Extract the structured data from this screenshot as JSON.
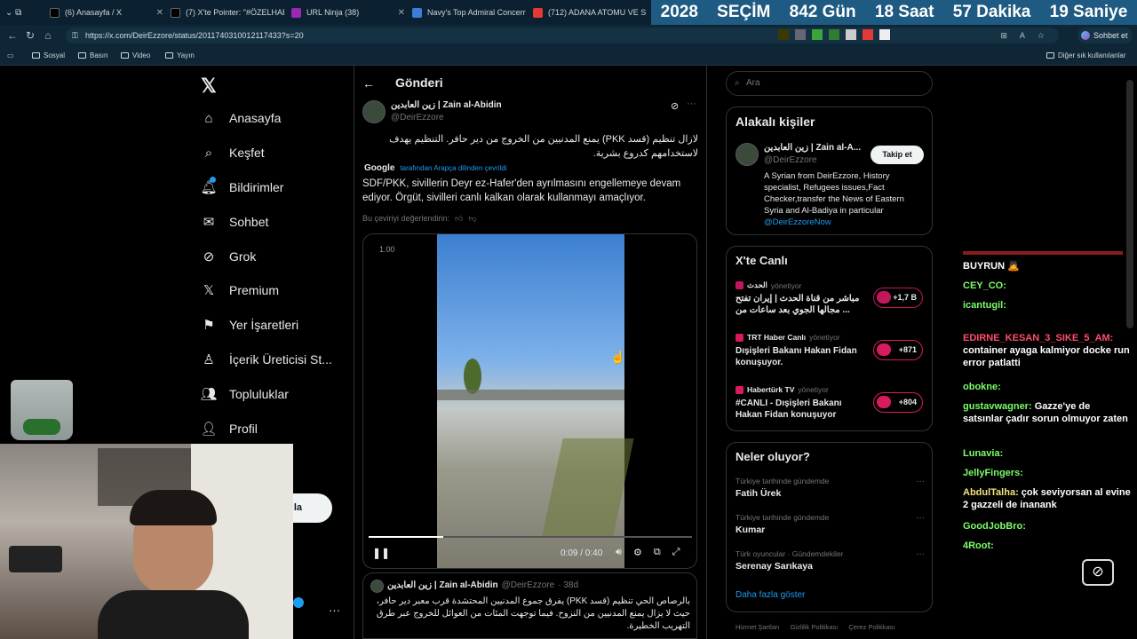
{
  "tabs": [
    {
      "label": "(6) Anasayfa / X",
      "fav": "#000"
    },
    {
      "label": "(7) X'te Pointer: \"#ÖZELHABER",
      "fav": "#000"
    },
    {
      "label": "URL Ninja (38)",
      "fav": "#9c27b0"
    },
    {
      "label": "Navy's Top Admiral Concerns",
      "fav": "#3b7dd8"
    },
    {
      "label": "(712) ADANA ATOMU VE SU",
      "fav": "#e53935"
    }
  ],
  "countdown": {
    "year": "2028",
    "word": "SEÇİM",
    "days": "842 Gün",
    "hours": "18 Saat",
    "minutes": "57 Dakika",
    "seconds": "19 Saniye"
  },
  "address": {
    "url": "https://x.com/DeirEzzore/status/2011740310012117433?s=20",
    "chat_label": "Sohbet et"
  },
  "bookmarks": [
    "Sosyal",
    "Basın",
    "Video",
    "Yayın"
  ],
  "bookmarks_other": "Diğer sık kullanılanlar",
  "nav": {
    "items": [
      "Anasayfa",
      "Keşfet",
      "Bildirimler",
      "Sohbet",
      "Grok",
      "Premium",
      "Yer İşaretleri",
      "İçerik Üreticisi St...",
      "Topluluklar",
      "Profil"
    ],
    "post_button_partial": "la"
  },
  "post": {
    "header": "Gönderi",
    "author_name": "زين العابدين | Zain al-Abidin",
    "author_handle": "@DeirEzzore",
    "arabic_text": "لازال تنظيم (قسد PKK) يمنع المدنيين من الخروج من دير حافر. التنظيم يهدف لاستخدامهم كدروع بشرية.",
    "translator": "Google",
    "translated_note": "tarafından Arapça dilinden çevrildi",
    "translation": "SDF/PKK, sivillerin Deyr ez-Hafer'den ayrılmasını engellemeye devam ediyor. Örgüt, sivilleri canlı kalkan olarak kullanmayı amaçlıyor.",
    "rate": "Bu çeviriyi değerlendirin:",
    "video": {
      "speed": "1.00",
      "time": "0:09 / 0:40",
      "progress": 0.23
    }
  },
  "quote": {
    "author_name": "زين العابدين | Zain al-Abidin",
    "author_handle": "@DeirEzzore",
    "age": "· 38d",
    "text": "بالرصاص الحي تنظيم (قسد PKK) يفرق جموع المدنيين المحتشدة قرب معبر دير حافر، حيث لا يزال يمنع المدنيين من النزوح. فيما توجهت المئات من العوائل للخروج عبر طرق التهريب الخطيرة."
  },
  "search": {
    "placeholder": "Ara"
  },
  "related": {
    "title": "Alakalı kişiler",
    "name": "زين العابدين | Zain al-A...",
    "handle": "@DeirEzzore",
    "follow": "Takip et",
    "bio": "A Syrian from DeirEzzore, History specialist, Refugees issues,Fact Checker,transfer the News of Eastern Syria and Al-Badiya in particular",
    "link": "@DeirEzzoreNow"
  },
  "live": {
    "title": "X'te Canlı",
    "items": [
      {
        "host": "الحدث",
        "role": "yönetiyor",
        "text": "مباشر من قناة الحدث | إيران تفتح مجالها الجوي بعد ساعات من ...",
        "count": "+1,7 B",
        "color": "#c2185b"
      },
      {
        "host": "TRT Haber Canlı",
        "role": "yönetiyor",
        "text": "Dışişleri Bakanı Hakan Fidan konuşuyor.",
        "count": "+871",
        "color": "#d81b60"
      },
      {
        "host": "Habertürk TV",
        "role": "yönetiyor",
        "text": "#CANLI - Dışişleri Bakanı Hakan Fidan konuşuyor",
        "count": "+804",
        "color": "#d81b60"
      }
    ]
  },
  "trends": {
    "title": "Neler oluyor?",
    "items": [
      {
        "context": "Türkiye tarihinde gündemde",
        "name": "Fatih Ürek"
      },
      {
        "context": "Türkiye tarihinde gündemde",
        "name": "Kumar"
      },
      {
        "context": "Türk oyuncular · Gündemdekiler",
        "name": "Serenay Sarıkaya"
      }
    ],
    "more": "Daha fazla göster"
  },
  "footer_links": [
    "Hizmet Şartları",
    "Gizlilik Politikası",
    "Çerez Politikası"
  ],
  "chat": [
    {
      "user": "",
      "msg": "BUYRUN 🙇"
    },
    {
      "user": "CEY_CO:",
      "msg": ""
    },
    {
      "user": "icantugil:",
      "msg": ""
    },
    {
      "user": "EDIRNE_KESAN_3_SIKE_5_AM:",
      "msg": "container ayaga kalmiyor docke run error patlatti"
    },
    {
      "user": "obokne:",
      "msg": ""
    },
    {
      "user": "gustavwagner:",
      "msg": "Gazze'ye de satsınlar çadır sorun olmuyor zaten"
    },
    {
      "user": "Lunavia:",
      "msg": ""
    },
    {
      "user": "JellyFingers:",
      "msg": ""
    },
    {
      "user": "AbdulTalha:",
      "msg": "çok seviyorsan al evine 2 gazzeli de inanank"
    },
    {
      "user": "GoodJobBro:",
      "msg": ""
    },
    {
      "user": "4Root:",
      "msg": ""
    }
  ],
  "colors": {
    "accent": "#1d9bf0",
    "border": "#2f3336",
    "muted": "#71767b",
    "countdown_bg": "#1e5a82"
  }
}
